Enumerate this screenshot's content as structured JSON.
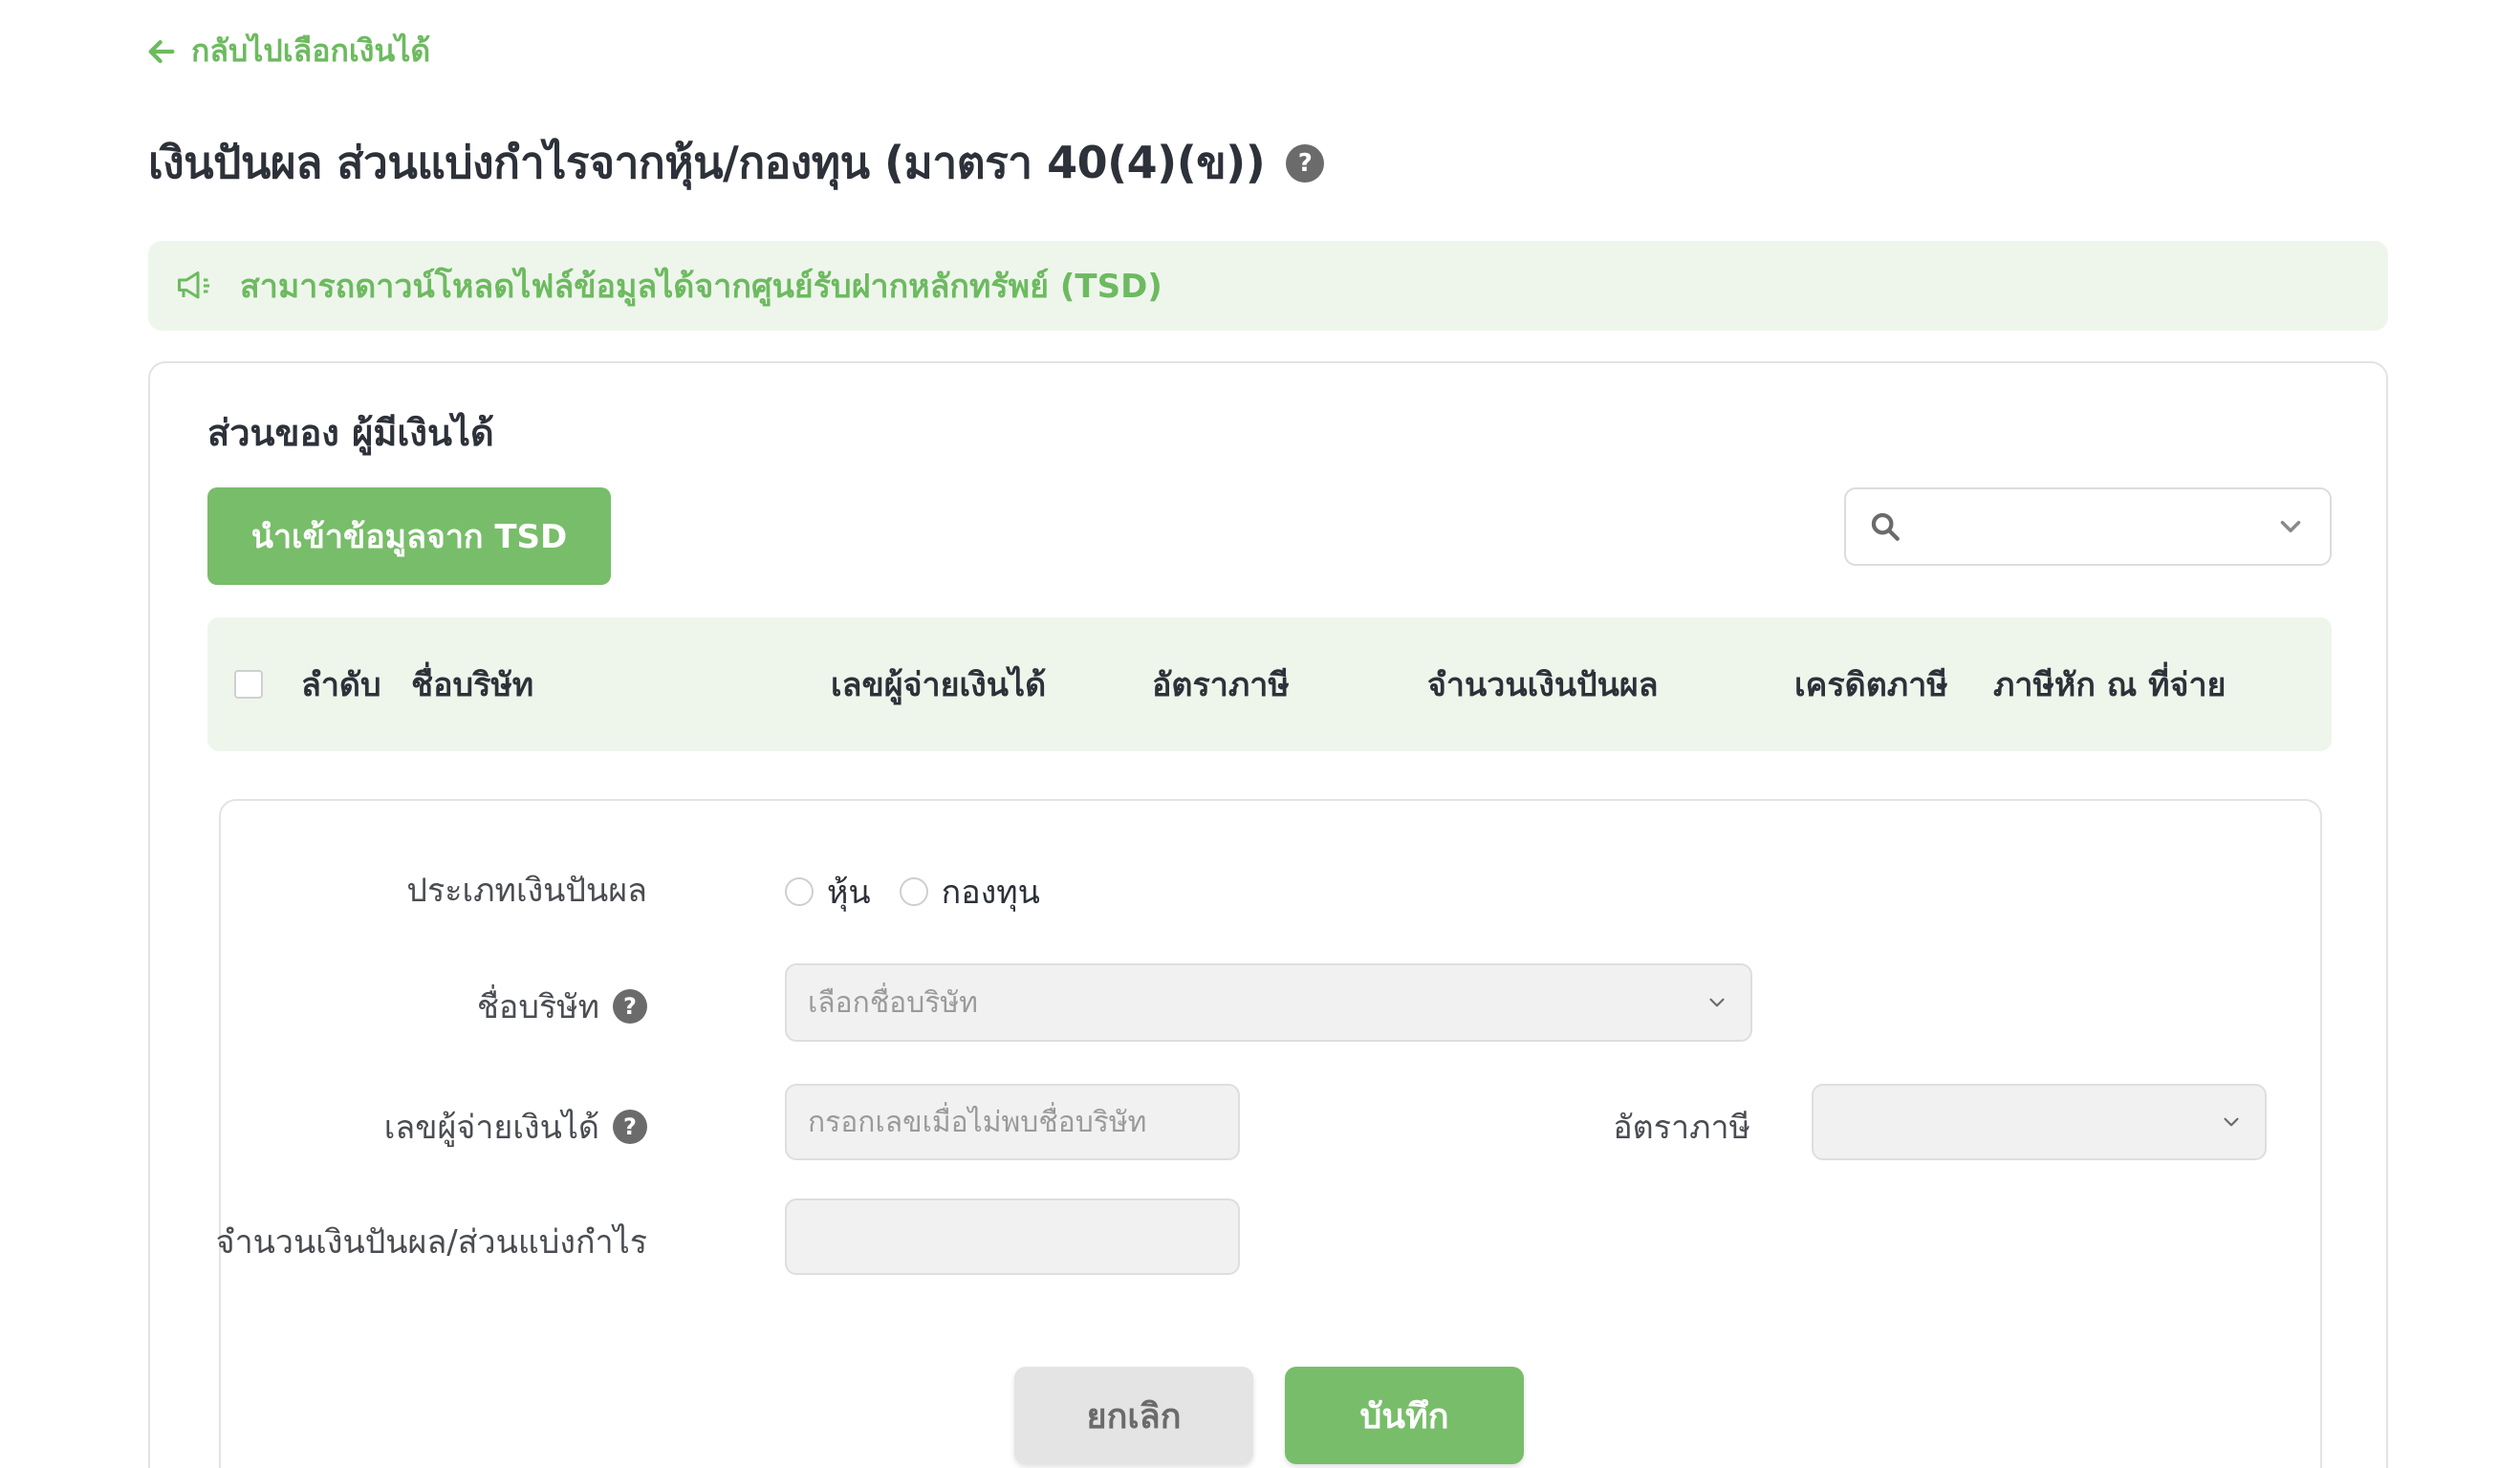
{
  "back_link": {
    "label": "กลับไปเลือกเงินได้",
    "icon": "arrow-left-icon"
  },
  "page": {
    "title": "เงินปันผล ส่วนแบ่งกำไรจากหุ้น/กองทุน (มาตรา 40(4)(ข))",
    "help_icon": "?"
  },
  "notice": {
    "icon": "megaphone-icon",
    "text": "สามารถดาวน์โหลดไฟล์ข้อมูลได้จากศูนย์รับฝากหลักทรัพย์ (TSD)"
  },
  "section": {
    "title": "ส่วนของ ผู้มีเงินได้",
    "import_button": "นำเข้าข้อมูลจาก TSD",
    "search": {
      "value": "",
      "icon": "search-icon"
    }
  },
  "table": {
    "columns": [
      "ลำดับ",
      "ชื่อบริษัท",
      "เลขผู้จ่ายเงินได้",
      "อัตราภาษี",
      "จำนวนเงินปันผล",
      "เครดิตภาษี",
      "ภาษีหัก ณ ที่จ่าย"
    ]
  },
  "form": {
    "dividend_type": {
      "label": "ประเภทเงินปันผล",
      "options": [
        "หุ้น",
        "กองทุน"
      ]
    },
    "company": {
      "label": "ชื่อบริษัท",
      "placeholder": "เลือกชื่อบริษัท"
    },
    "payer_id": {
      "label": "เลขผู้จ่ายเงินได้",
      "placeholder": "กรอกเลขเมื่อไม่พบชื่อบริษัท"
    },
    "tax_rate": {
      "label": "อัตราภาษี",
      "value": ""
    },
    "amount": {
      "label": "จำนวนเงินปันผล/ส่วนแบ่งกำไร",
      "value": ""
    },
    "cancel_button": "ยกเลิก",
    "save_button": "บันทึก"
  },
  "colors": {
    "accent": "#78bd6a",
    "accent_text": "#6dba60",
    "notice_bg": "#eef6ec",
    "help_icon_bg": "#6b6b6b"
  }
}
